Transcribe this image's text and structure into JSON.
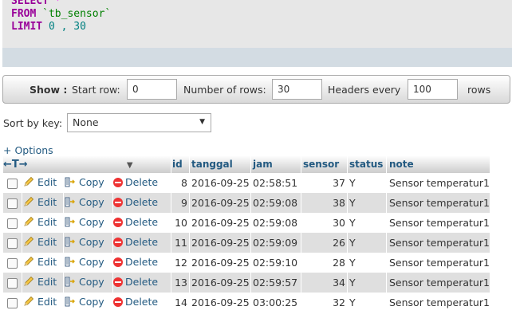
{
  "sql": {
    "select_kw": "SELECT",
    "star": "*",
    "from_kw": "FROM",
    "table": "`tb_sensor`",
    "limit_kw": "LIMIT",
    "offset": "0",
    "comma": ",",
    "count": "30"
  },
  "nav": {
    "show_label": "Show :",
    "start_row_label": "Start row:",
    "start_row_value": "0",
    "rows_label": "Number of rows:",
    "rows_value": "30",
    "headers_label": "Headers every",
    "headers_value": "100",
    "rows_suffix": "rows"
  },
  "sort": {
    "label": "Sort by key:",
    "selected": "None"
  },
  "options_link": "+ Options",
  "table": {
    "columns": [
      "id",
      "tanggal",
      "jam",
      "sensor",
      "status",
      "note"
    ],
    "actions": {
      "edit": "Edit",
      "copy": "Copy",
      "delete": "Delete"
    },
    "rows": [
      {
        "id": "8",
        "tanggal": "2016-09-25",
        "jam": "02:58:51",
        "sensor": "37",
        "status": "Y",
        "note": "Sensor temperatur1"
      },
      {
        "id": "9",
        "tanggal": "2016-09-25",
        "jam": "02:59:08",
        "sensor": "38",
        "status": "Y",
        "note": "Sensor temperatur1"
      },
      {
        "id": "10",
        "tanggal": "2016-09-25",
        "jam": "02:59:08",
        "sensor": "30",
        "status": "Y",
        "note": "Sensor temperatur1"
      },
      {
        "id": "11",
        "tanggal": "2016-09-25",
        "jam": "02:59:09",
        "sensor": "26",
        "status": "Y",
        "note": "Sensor temperatur1"
      },
      {
        "id": "12",
        "tanggal": "2016-09-25",
        "jam": "02:59:10",
        "sensor": "28",
        "status": "Y",
        "note": "Sensor temperatur1"
      },
      {
        "id": "13",
        "tanggal": "2016-09-25",
        "jam": "02:59:57",
        "sensor": "34",
        "status": "Y",
        "note": "Sensor temperatur1"
      },
      {
        "id": "14",
        "tanggal": "2016-09-25",
        "jam": "03:00:25",
        "sensor": "32",
        "status": "Y",
        "note": "Sensor temperatur1"
      }
    ]
  },
  "icons": {
    "edit": "pencil-icon",
    "copy": "copy-icon",
    "delete": "delete-icon",
    "column_arrows": "resize-arrows-icon",
    "sort_menu": "triangle-down-icon"
  }
}
